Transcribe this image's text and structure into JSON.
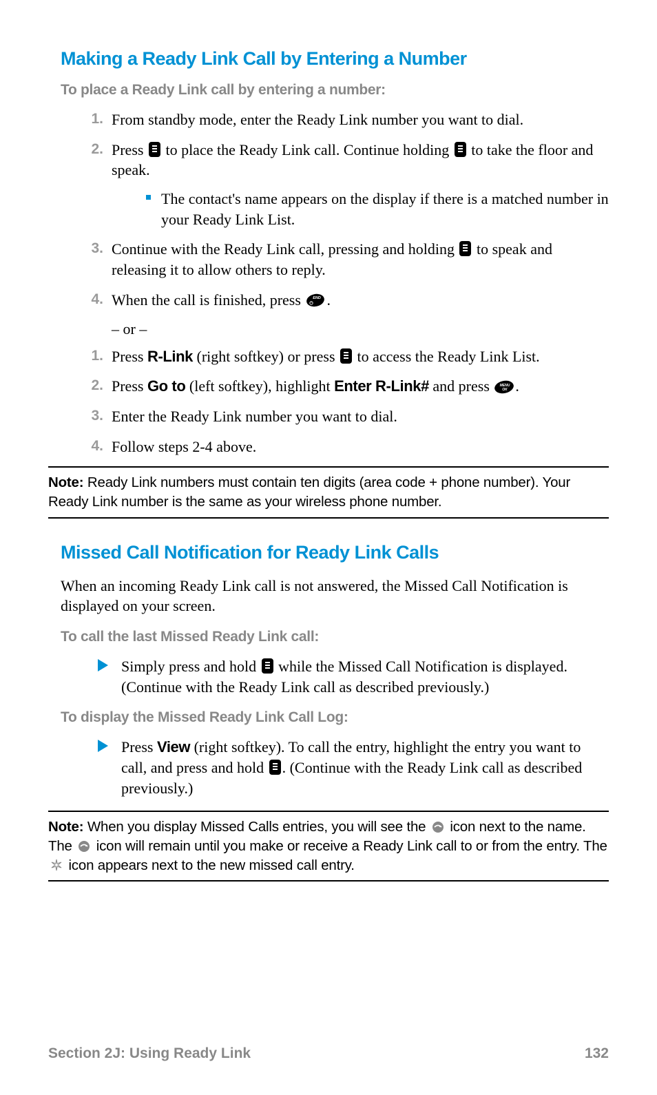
{
  "section1": {
    "heading": "Making a Ready Link Call by Entering a Number",
    "sub1": "To place a Ready Link call by entering a number:",
    "steps_a": {
      "s1": "From standby mode, enter the Ready Link number you want to dial.",
      "s2a": "Press ",
      "s2b": " to place the Ready Link call. Continue holding ",
      "s2c": " to take the floor and speak.",
      "bullet": "The contact's name appears on the display if there is a matched number in your Ready Link List.",
      "s3a": "Continue with the Ready Link call, pressing and holding ",
      "s3b": " to speak and releasing it to allow others to reply.",
      "s4a": "When the call is finished, press ",
      "s4b": "."
    },
    "or": "– or –",
    "steps_b": {
      "s1a": "Press ",
      "s1_rlink": "R-Link",
      "s1b": " (right softkey) or press ",
      "s1c": " to access the Ready Link List.",
      "s2a": "Press ",
      "s2_goto": "Go to",
      "s2b": " (left softkey), highlight ",
      "s2_enter": "Enter R-Link#",
      "s2c": " and press ",
      "s2d": ".",
      "s3": "Enter the Ready Link number you want to dial.",
      "s4": "Follow steps 2-4 above."
    },
    "note": {
      "label": "Note:",
      "text": " Ready Link numbers must contain ten digits (area code + phone number). Your Ready Link number is the same as your wireless phone number."
    }
  },
  "section2": {
    "heading": "Missed Call Notification for Ready Link Calls",
    "intro": "When an incoming Ready Link call is not answered, the Missed Call Notification is displayed on your screen.",
    "sub1": "To call the last Missed Ready Link call:",
    "arrow1a": "Simply press and hold ",
    "arrow1b": " while the Missed Call Notification is displayed. (Continue with the Ready Link call as described previously.)",
    "sub2": "To display the Missed Ready Link Call Log:",
    "arrow2a": "Press ",
    "arrow2_view": "View",
    "arrow2b": " (right softkey). To call the entry, highlight the entry you want to call, and press and hold ",
    "arrow2c": ". (Continue with the Ready Link call as described previously.)",
    "note": {
      "label": "Note:",
      "t1": " When you display Missed Calls entries, you will see the ",
      "t2": " icon next to the name. The ",
      "t3": " icon will remain until you make or receive a Ready Link call to or from the entry. The ",
      "t4": " icon appears next to the new missed call entry."
    }
  },
  "footer": {
    "left": "Section 2J: Using Ready Link",
    "right": "132"
  }
}
